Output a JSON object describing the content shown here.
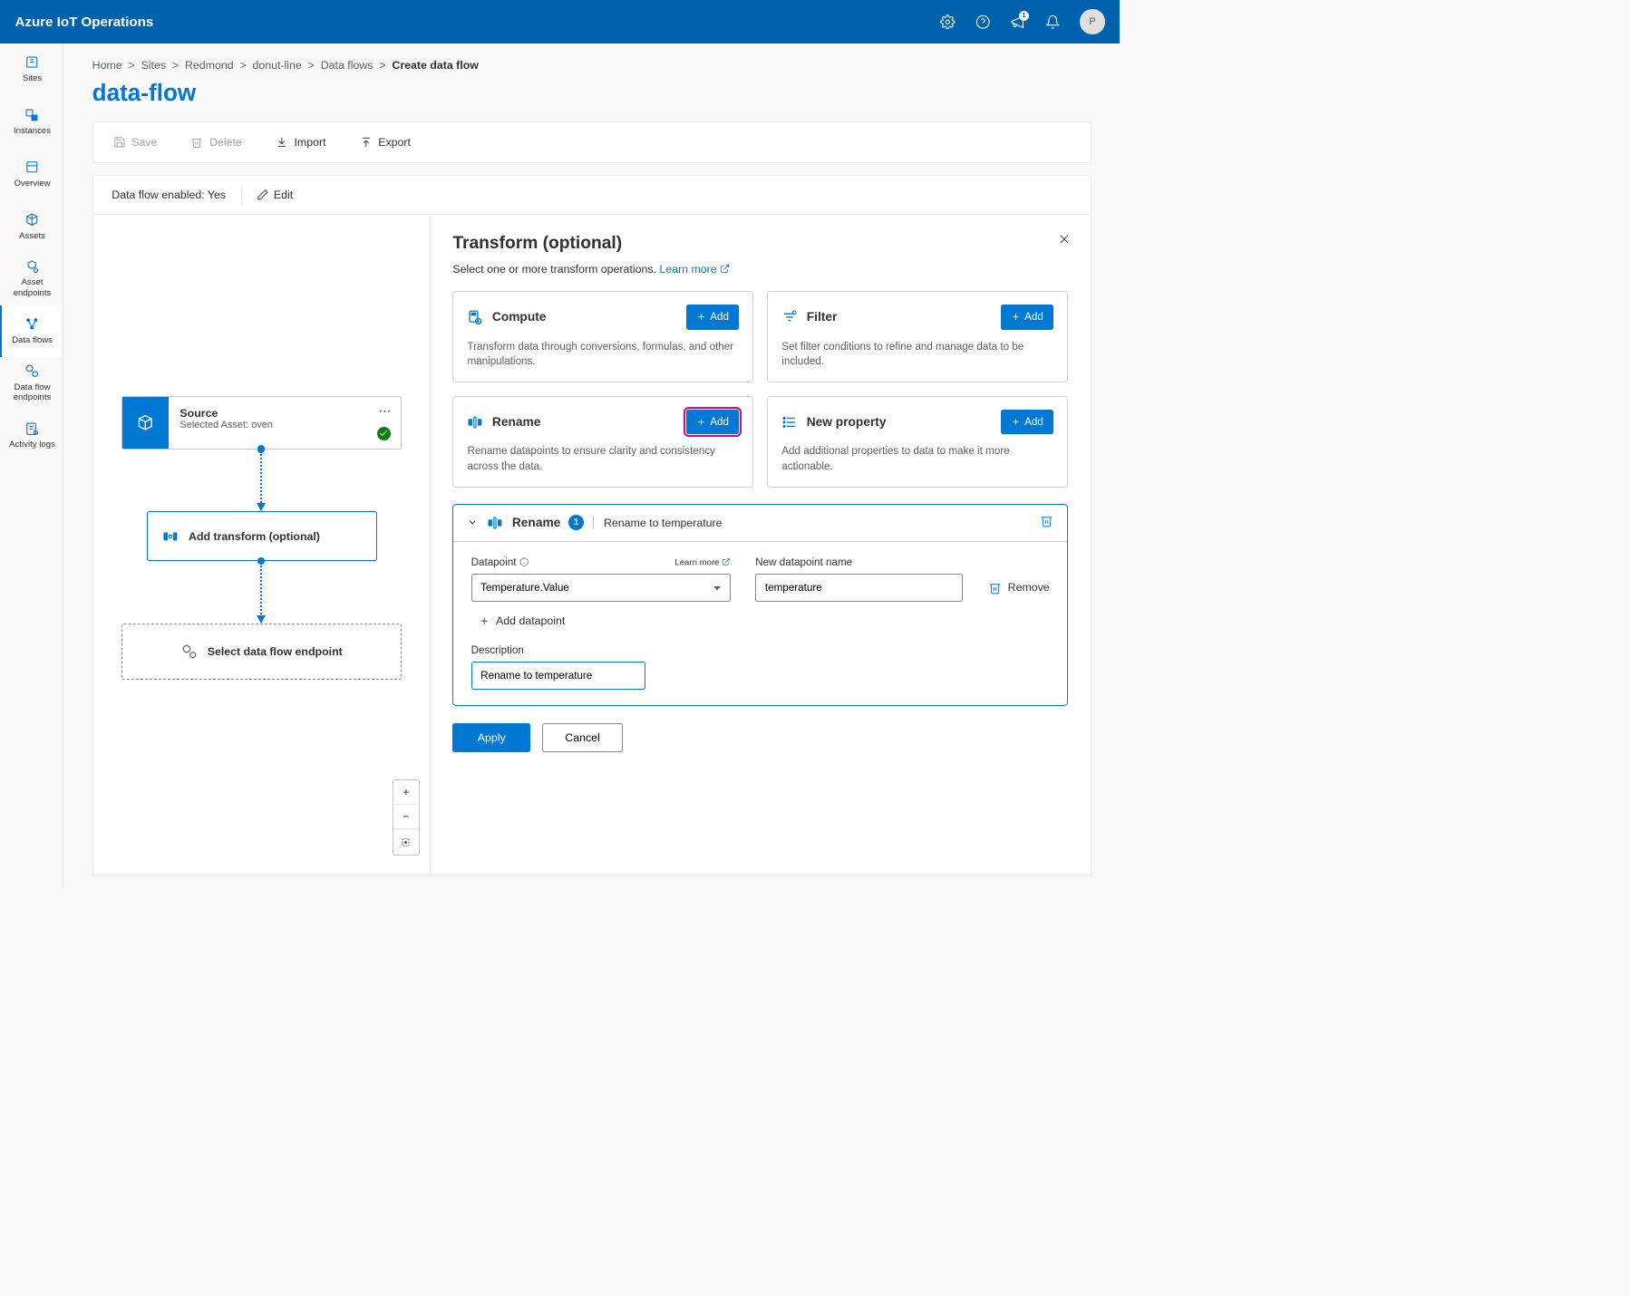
{
  "header": {
    "title": "Azure IoT Operations",
    "badge": "1",
    "avatar": "P"
  },
  "sidebar": {
    "items": [
      {
        "label": "Sites",
        "icon": "sites"
      },
      {
        "label": "Instances",
        "icon": "instances"
      },
      {
        "label": "Overview",
        "icon": "overview"
      },
      {
        "label": "Assets",
        "icon": "assets"
      },
      {
        "label": "Asset endpoints",
        "icon": "asset-endpoints"
      },
      {
        "label": "Data flows",
        "icon": "data-flows",
        "active": true
      },
      {
        "label": "Data flow endpoints",
        "icon": "dataflow-endpoints"
      },
      {
        "label": "Activity logs",
        "icon": "activity-logs"
      }
    ]
  },
  "breadcrumb": [
    "Home",
    "Sites",
    "Redmond",
    "donut-line",
    "Data flows",
    "Create data flow"
  ],
  "page_title": "data-flow",
  "toolbar": {
    "save": "Save",
    "delete": "Delete",
    "import": "Import",
    "export": "Export"
  },
  "status": {
    "enabled_label": "Data flow enabled: Yes",
    "edit": "Edit"
  },
  "flow": {
    "source": {
      "title": "Source",
      "subtitle": "Selected Asset: oven"
    },
    "transform_label": "Add transform (optional)",
    "endpoint_label": "Select data flow endpoint"
  },
  "panel": {
    "title": "Transform (optional)",
    "subtitle": "Select one or more transform operations. ",
    "learn_more": "Learn more",
    "add_label": "Add",
    "cards": {
      "compute": {
        "title": "Compute",
        "desc": "Transform data through conversions, formulas, and other manipulations."
      },
      "filter": {
        "title": "Filter",
        "desc": "Set filter conditions to refine and manage data to be included."
      },
      "rename": {
        "title": "Rename",
        "desc": "Rename datapoints to ensure clarity and consistency across the data."
      },
      "newprop": {
        "title": "New property",
        "desc": "Add additional properties to data to make it more actionable."
      }
    },
    "rename_config": {
      "header_title": "Rename",
      "count": "1",
      "summary": "Rename to temperature",
      "datapoint_label": "Datapoint",
      "learn_more": "Learn more",
      "datapoint_value": "Temperature.Value",
      "newname_label": "New datapoint name",
      "newname_value": "temperature",
      "remove_label": "Remove",
      "add_datapoint": "Add datapoint",
      "description_label": "Description",
      "description_value": "Rename to temperature"
    },
    "actions": {
      "apply": "Apply",
      "cancel": "Cancel"
    }
  }
}
